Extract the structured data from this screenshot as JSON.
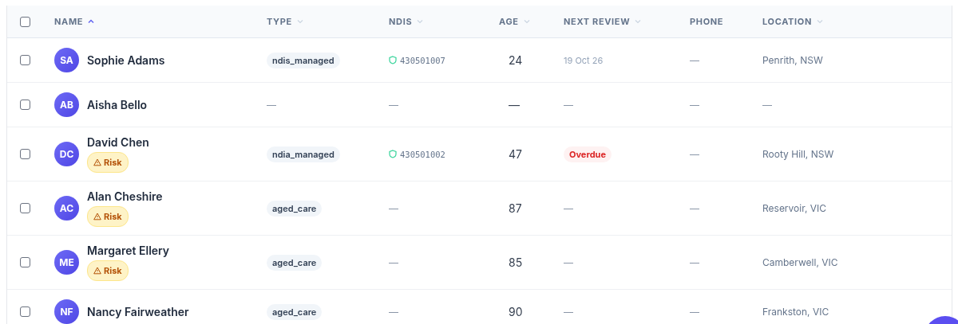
{
  "table": {
    "select_all": {
      "checked": false
    },
    "columns": [
      {
        "label": "NAME",
        "sortable": true,
        "sorted": true
      },
      {
        "label": "TYPE",
        "sortable": true,
        "sorted": false
      },
      {
        "label": "NDIS",
        "sortable": true,
        "sorted": false
      },
      {
        "label": "AGE",
        "sortable": true,
        "sorted": false
      },
      {
        "label": "NEXT REVIEW",
        "sortable": true,
        "sorted": false
      },
      {
        "label": "PHONE",
        "sortable": false,
        "sorted": false
      },
      {
        "label": "LOCATION",
        "sortable": true,
        "sorted": false
      }
    ],
    "rows": [
      {
        "checked": false,
        "initials": "SA",
        "name": "Sophie Adams",
        "type": {
          "kind": "tag",
          "text": "ndis_managed"
        },
        "ndis": {
          "kind": "id",
          "text": "430501007"
        },
        "age": {
          "kind": "value",
          "text": "24"
        },
        "next_review": {
          "kind": "date",
          "text": "19 Oct 26"
        },
        "phone": {
          "kind": "empty",
          "text": "—"
        },
        "location": {
          "kind": "value",
          "text": "Penrith, NSW"
        }
      },
      {
        "checked": false,
        "initials": "AB",
        "name": "Aisha Bello",
        "type": {
          "kind": "empty",
          "text": "—"
        },
        "ndis": {
          "kind": "empty",
          "text": "—"
        },
        "age": {
          "kind": "value",
          "text": "—"
        },
        "next_review": {
          "kind": "empty",
          "text": "—"
        },
        "phone": {
          "kind": "empty",
          "text": "—"
        },
        "location": {
          "kind": "empty",
          "text": "—"
        }
      },
      {
        "checked": false,
        "initials": "DC",
        "name": "David Chen",
        "risk": "Risk",
        "type": {
          "kind": "tag",
          "text": "ndia_managed"
        },
        "ndis": {
          "kind": "id",
          "text": "430501002"
        },
        "age": {
          "kind": "value",
          "text": "47"
        },
        "next_review": {
          "kind": "overdue",
          "text": "Overdue"
        },
        "phone": {
          "kind": "empty",
          "text": "—"
        },
        "location": {
          "kind": "value",
          "text": "Rooty Hill, NSW"
        }
      },
      {
        "checked": false,
        "initials": "AC",
        "name": "Alan Cheshire",
        "risk": "Risk",
        "type": {
          "kind": "tag",
          "text": "aged_care"
        },
        "ndis": {
          "kind": "empty",
          "text": "—"
        },
        "age": {
          "kind": "value",
          "text": "87"
        },
        "next_review": {
          "kind": "empty",
          "text": "—"
        },
        "phone": {
          "kind": "empty",
          "text": "—"
        },
        "location": {
          "kind": "value",
          "text": "Reservoir, VIC"
        }
      },
      {
        "checked": false,
        "initials": "ME",
        "name": "Margaret Ellery",
        "risk": "Risk",
        "type": {
          "kind": "tag",
          "text": "aged_care"
        },
        "ndis": {
          "kind": "empty",
          "text": "—"
        },
        "age": {
          "kind": "value",
          "text": "85"
        },
        "next_review": {
          "kind": "empty",
          "text": "—"
        },
        "phone": {
          "kind": "empty",
          "text": "—"
        },
        "location": {
          "kind": "value",
          "text": "Camberwell, VIC"
        }
      },
      {
        "checked": false,
        "initials": "NF",
        "name": "Nancy Fairweather",
        "type": {
          "kind": "tag",
          "text": "aged_care"
        },
        "ndis": {
          "kind": "empty",
          "text": "—"
        },
        "age": {
          "kind": "value",
          "text": "90"
        },
        "next_review": {
          "kind": "empty",
          "text": "—"
        },
        "phone": {
          "kind": "empty",
          "text": "—"
        },
        "location": {
          "kind": "value",
          "text": "Frankston, VIC"
        }
      }
    ]
  }
}
